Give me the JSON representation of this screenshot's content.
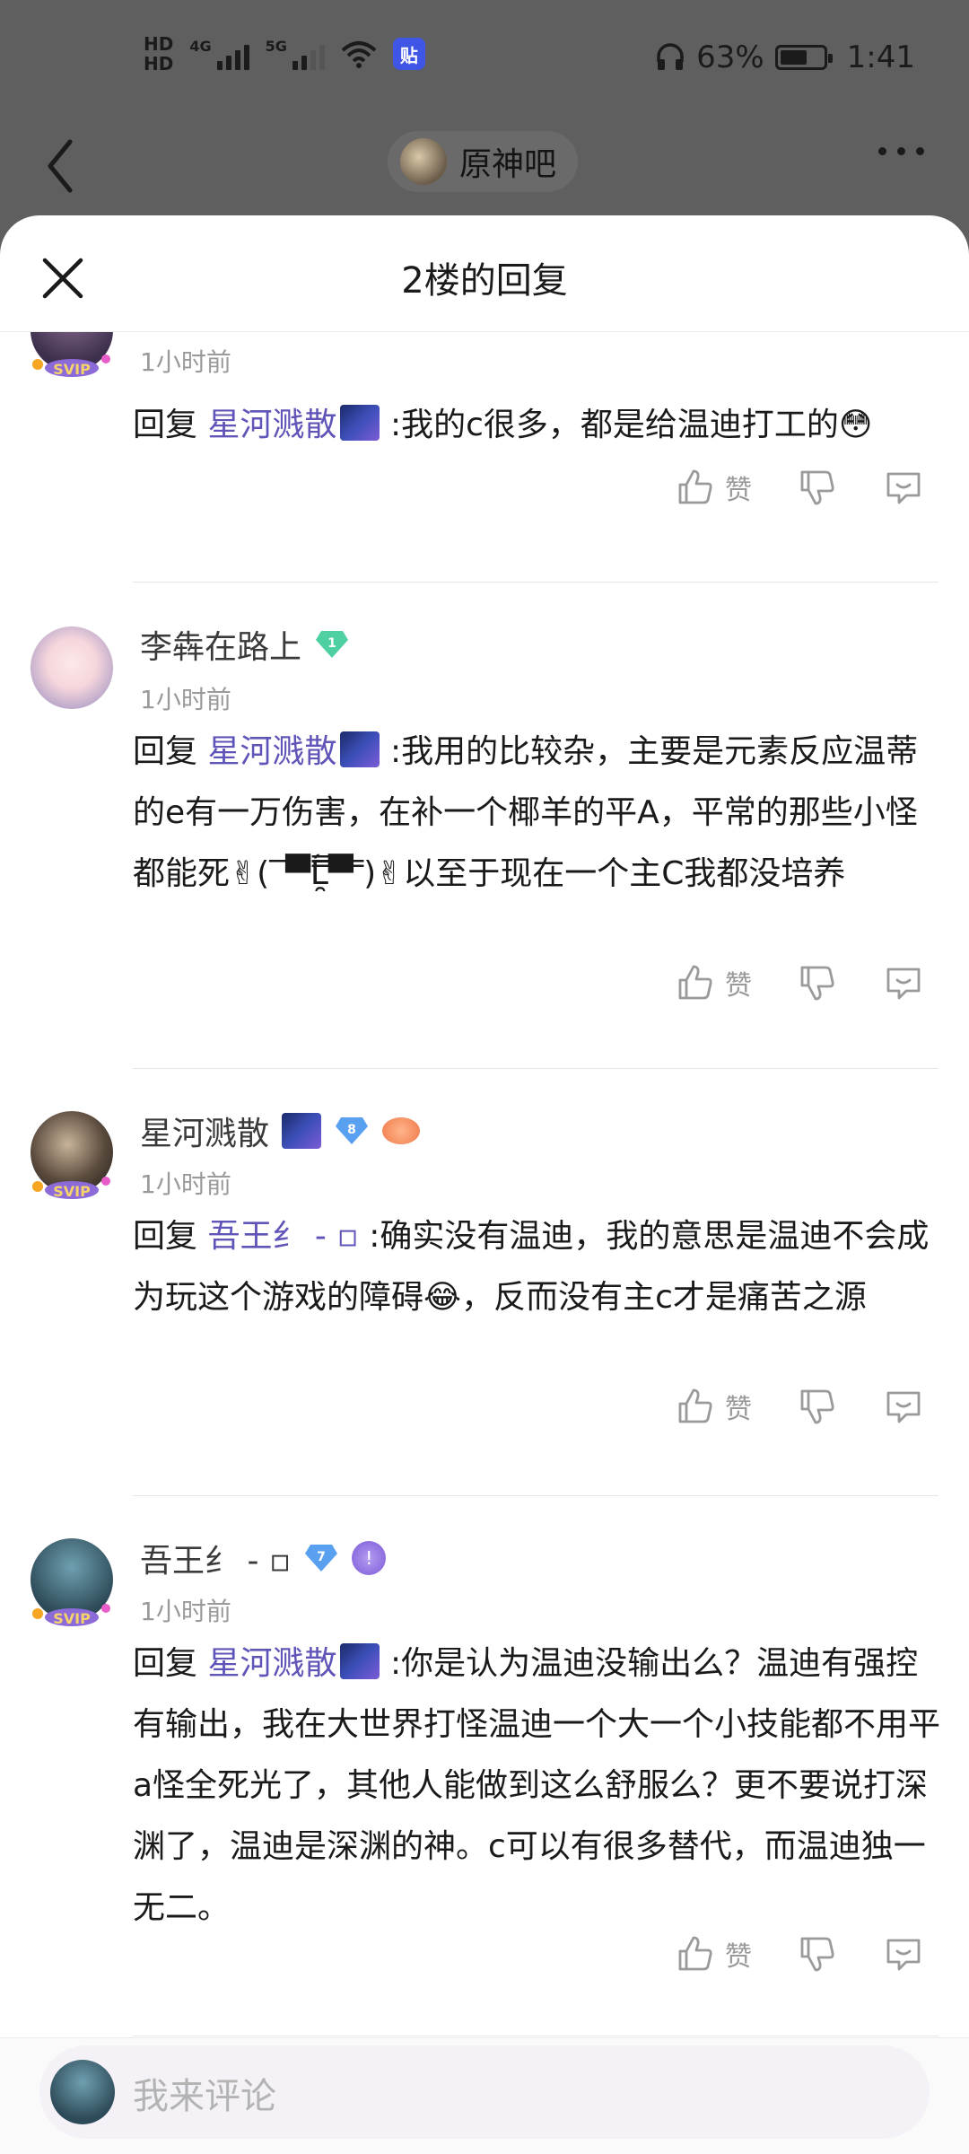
{
  "status_bar": {
    "hd1": "HD",
    "hd2": "HD",
    "net1": "4G",
    "net2": "5G",
    "app_badge": "贴",
    "battery_percent": "63%",
    "battery_level": 0.63,
    "time": "1:41"
  },
  "nav": {
    "forum_name": "原神吧"
  },
  "sheet": {
    "title": "2楼的回复"
  },
  "replies": [
    {
      "username": "",
      "time": "1小时前",
      "reply_prefix": "回复",
      "mention": "星河溅散",
      "text": ":我的c很多，都是给温迪打工的😳",
      "like_label": "赞"
    },
    {
      "username": "李犇在路上",
      "level": "1",
      "time": "1小时前",
      "reply_prefix": "回复",
      "mention": "星河溅散",
      "text": ":我用的比较杂，主要是元素反应温蒂的e有一万伤害，在补一个椰羊的平A，平常的那些小怪都能死✌(‾▀̿̿Ĺ̯̿̿▀̿ ̿)✌以至于现在一个主C我都没培养",
      "like_label": "赞"
    },
    {
      "username": "星河溅散",
      "level": "8",
      "time": "1小时前",
      "reply_prefix": "回复",
      "mention": "吾王纟 - ▫",
      "text": ":确实没有温迪，我的意思是温迪不会成为玩这个游戏的障碍😂，反而没有主c才是痛苦之源",
      "like_label": "赞"
    },
    {
      "username": "吾王纟 - ▫",
      "level": "7",
      "time": "1小时前",
      "reply_prefix": "回复",
      "mention": "星河溅散",
      "text": ":你是认为温迪没输出么？温迪有强控有输出，我在大世界打怪温迪一个大一个小技能都不用平a怪全死光了，其他人能做到这么舒服么？更不要说打深渊了，温迪是深渊的神。c可以有很多替代，而温迪独一无二。",
      "like_label": "赞"
    }
  ],
  "composer": {
    "placeholder": "我来评论"
  },
  "icons": {
    "back": "chevron-left-icon",
    "more": "more-horizontal-icon",
    "close": "close-icon",
    "like": "thumbs-up-icon",
    "dislike": "thumbs-down-icon",
    "comment": "chat-bubble-icon"
  },
  "colors": {
    "mention": "#5f54b8",
    "level_badge": "#5aa0f0",
    "level_badge_green": "#4fd0a0"
  }
}
